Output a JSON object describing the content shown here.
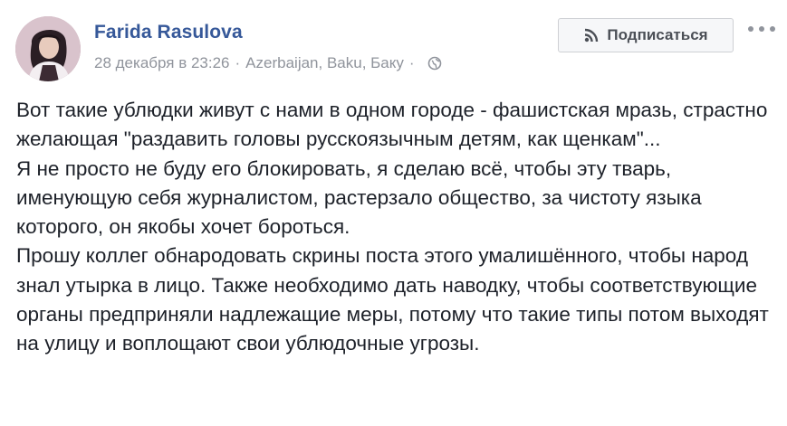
{
  "post": {
    "author": "Farida Rasulova",
    "date": "28 декабря в 23:26",
    "separator": "·",
    "location": "Azerbaijan, Baku, Баку",
    "privacy_icon": "globe-icon",
    "subscribe_label": "Подписаться",
    "subscribe_icon": "rss-icon",
    "more_icon": "more-dots-icon",
    "paragraphs": [
      "Вот такие ублюдки живут с нами в одном городе - фашистская мразь, страстно желающая \"раздавить головы русскоязычным детям, как щенкам\"...",
      "Я не просто не буду его блокировать, я сделаю всё, чтобы эту тварь, именующую себя журналистом, растерзало общество, за чистоту языка которого, он якобы хочет бороться.",
      "Прошу коллег обнародовать скрины поста этого умалишённого, чтобы народ знал утырка в лицо. Также необходимо дать наводку, чтобы соответствующие органы предприняли надлежащие меры, потому что такие типы потом выходят на улицу и воплощают свои ублюдочные угрозы."
    ]
  },
  "colors": {
    "author": "#365899",
    "meta": "#90949c",
    "body_text": "#1d2129",
    "button_bg": "#f6f7f9",
    "button_border": "#ced0d4"
  }
}
